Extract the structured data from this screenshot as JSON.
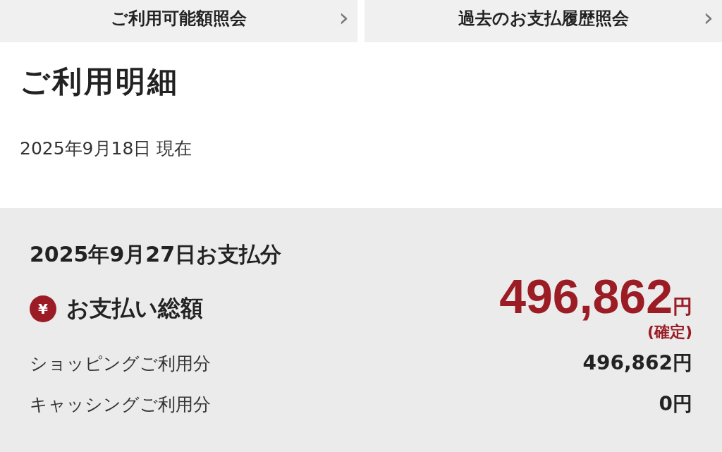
{
  "nav_buttons": [
    {
      "label": "ご利用可能額照会",
      "chevron": "›"
    },
    {
      "label": "過去のお支払履歴照会",
      "chevron": "›"
    }
  ],
  "title": "ご利用明細",
  "as_of": "2025年9月18日 現在",
  "payment": {
    "heading": "2025年9月27日お支払分",
    "total_icon": "¥",
    "total_label": "お支払い総額",
    "total_amount": "496,862",
    "total_unit": "円",
    "total_status": "(確定)",
    "breakdown": [
      {
        "label": "ショッピングご利用分",
        "amount": "496,862円"
      },
      {
        "label": "キャッシングご利用分",
        "amount": "0円"
      }
    ]
  }
}
